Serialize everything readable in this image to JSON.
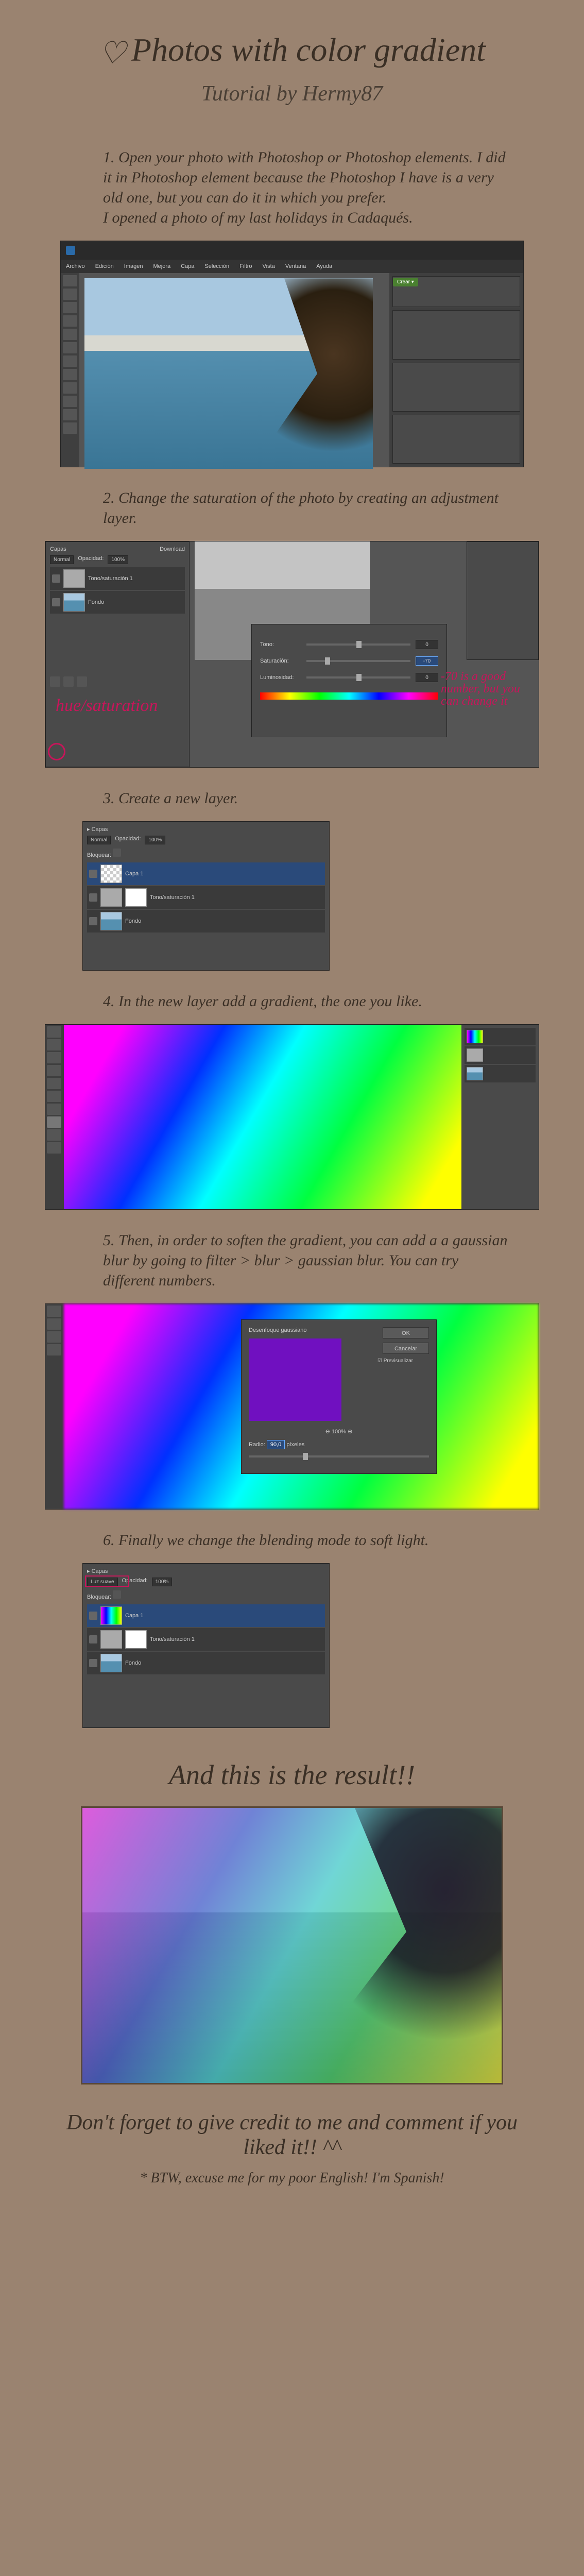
{
  "title": "Photos with color gradient",
  "subtitle": "Tutorial by Hermy87",
  "steps": {
    "s1": "1. Open your photo with Photoshop or Photoshop elements. I did it in Photoshop element because the Photoshop I have is a very old one, but you can do it in which you prefer.\nI opened a photo of my last holidays in Cadaqués.",
    "s2": "2. Change the saturation of the photo by creating an adjustment layer.",
    "s3": "3. Create a new layer.",
    "s4": "4. In the new layer add a gradient, the one you like.",
    "s5": "5. Then, in order to soften the gradient, you can add a a gaussian blur by going to filter > blur > gaussian blur. You can try different numbers.",
    "s6": "6. Finally we change the blending mode to soft light."
  },
  "annotations": {
    "hue_sat": "hue/saturation",
    "neg70": "-70 is a good number, but you can change it"
  },
  "panels": {
    "capas": "Capas",
    "normal": "Normal",
    "luz_suave": "Luz suave",
    "opacidad": "Opacidad:",
    "opacity_val": "100%",
    "bloquear": "Bloquear:",
    "capa1": "Capa 1",
    "tono_sat": "Tono/saturación 1",
    "fondo": "Fondo",
    "download": "Download"
  },
  "hue_dialog": {
    "tono": "Tono:",
    "tono_val": "0",
    "sat": "Saturación:",
    "sat_val": "-70",
    "lum": "Luminosidad:",
    "lum_val": "0"
  },
  "blur_dialog": {
    "title": "Desenfoque gaussiano",
    "ok": "OK",
    "cancel": "Cancelar",
    "preview": "Previsualizar",
    "radio": "Radio:",
    "radio_val": "90,0",
    "pixels": "píxeles",
    "hundred": "100%"
  },
  "menu": {
    "m1": "Archivo",
    "m2": "Edición",
    "m3": "Imagen",
    "m4": "Mejora",
    "m5": "Capa",
    "m6": "Selección",
    "m7": "Filtro",
    "m8": "Vista",
    "m9": "Ventana",
    "m10": "Ayuda"
  },
  "result_heading": "And this is the result!!",
  "footer1": "Don't forget to give credit to me and comment if you liked it!! ^^",
  "footer2": "* BTW, excuse me for my poor English! I'm Spanish!"
}
